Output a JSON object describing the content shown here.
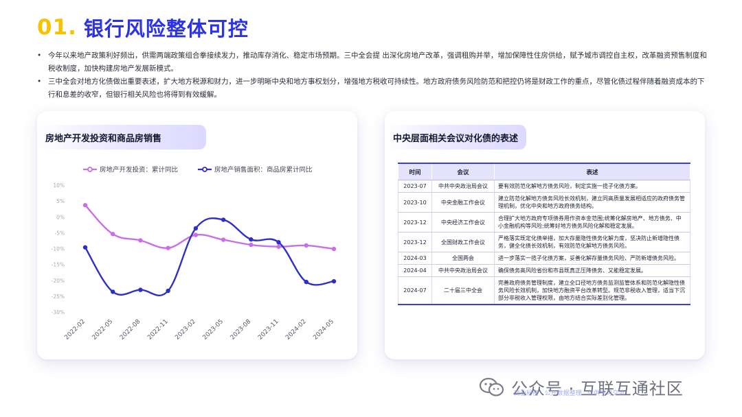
{
  "page": {
    "number": "01.",
    "title": "银行风险整体可控",
    "bullets": [
      "今年以来地产政策利好频出，供需两端政策组合拳接续发力，推动库存消化、稳定市场预期。三中全会提 出深化房地产改革，强调租购并举，增加保障性住房供给，赋予城市调控自主权，改革融资预售制度和税收制度，加快构建房地产发展新模式。",
      "三中全会对地方化债做出重要表述，扩大地方税源和财力，进一步明晰中央和地方事权划分，增强地方税收可持续性。地方政府债务风险防范和把控仍将是财政工作的重点，尽管化债过程伴随着融资成本的下行和息差的收窄，但银行相关风险也将得到有效缓解。"
    ]
  },
  "left_card": {
    "title": "房地产开发投资和商品房销售"
  },
  "chart_data": {
    "type": "line",
    "title": "",
    "xlabel": "",
    "ylabel": "",
    "ylim": [
      -30,
      10
    ],
    "yticks": [
      "10%",
      "5%",
      "0%",
      "-5%",
      "-10%",
      "-15%",
      "-20%",
      "-25%",
      "-30%"
    ],
    "ytick_values": [
      10,
      5,
      0,
      -5,
      -10,
      -15,
      -20,
      -25,
      -30
    ],
    "x": [
      "2022-02",
      "2022-03",
      "2022-04",
      "2022-05",
      "2022-06",
      "2022-07",
      "2022-08",
      "2022-09",
      "2022-10",
      "2022-11",
      "2022-12",
      "2023-01",
      "2023-02",
      "2023-03",
      "2023-04",
      "2023-05",
      "2023-06",
      "2023-07",
      "2023-08",
      "2023-09",
      "2023-10",
      "2023-11",
      "2023-12",
      "2024-01",
      "2024-02",
      "2024-03",
      "2024-04",
      "2024-05"
    ],
    "xtick_labels": [
      "2022-02",
      "2022-05",
      "2022-08",
      "2022-11",
      "2023-02",
      "2023-05",
      "2023-08",
      "2023-11",
      "2024-02",
      "2024-05"
    ],
    "grid": false,
    "legend_position": "top",
    "series": [
      {
        "name": "房地产开发投资：累计同比",
        "color": "#c86ee6",
        "anchor_x": [
          "2022-02",
          "2022-05",
          "2022-08",
          "2022-11",
          "2023-02",
          "2023-05",
          "2023-08",
          "2023-11",
          "2024-02",
          "2024-05"
        ],
        "values": [
          3.7,
          -5.4,
          -7.4,
          -9.8,
          -5.7,
          -7.2,
          -8.8,
          -9.4,
          -9.0,
          -10.1
        ]
      },
      {
        "name": "房地产销售面积：商品房累计同比",
        "color": "#2e2ec9",
        "anchor_x": [
          "2022-02",
          "2022-05",
          "2022-08",
          "2022-11",
          "2023-02",
          "2023-05",
          "2023-08",
          "2023-11",
          "2024-02",
          "2024-05"
        ],
        "values": [
          -9.6,
          -23.6,
          -23.0,
          -23.3,
          -3.6,
          -0.9,
          -7.1,
          -8.0,
          -20.5,
          -20.3
        ]
      }
    ]
  },
  "right_card": {
    "title": "中央层面相关会议对化债的表述",
    "table": {
      "headers": [
        "时间",
        "会议",
        "表述"
      ],
      "rows": [
        [
          "2023-07",
          "中共中央政治局会议",
          "要有效防范化解地方债务风险，制定实施一揽子化债方案。"
        ],
        [
          "2023-10",
          "中央金融工作会议",
          "建立防范化解地方债务风险长效机制，建立同高质量发展相适应的政府债务管理机制，优化中央和地方政府债务结构。"
        ],
        [
          "2023-12",
          "中央经济工作会议",
          "合理扩大地方政府专项债券用作资本金范围;统筹化解房地产、地方债务、中小金融机构等风险;统筹好地方债务风险化解和稳定发展。"
        ],
        [
          "2023-12",
          "全国财政工作会议",
          "严格落实既定化债举措，加大存量隐性债务化解力度，坚决防止新增隐性债务，健全化债长效机制，有效防范化解地方债务风险。"
        ],
        [
          "2024-03",
          "全国两会",
          "进一步落实一揽子化债方案，妥善化解存量债务风险、严防新增债务风险。"
        ],
        [
          "2024-04",
          "中共中央政治局会议",
          "确保债务高风险省份和市县既真正压降债务、又能稳定发展。"
        ],
        [
          "2024-07",
          "二十届三中全会",
          "完善政府债务管理制度，建立全口径地方债务监测监管体系和防范化解隐性债务风险长效机制，加快地方融资平台改革转型。规范非税收入管理，适当下沉部分非税收入管理权限，由地方结合实际差别化管理。"
        ]
      ]
    }
  },
  "watermark": {
    "text": "公众号 · 互联互通社区",
    "small_text": "商业秘密 · 公开数据整理 · 仅供学习交流"
  }
}
